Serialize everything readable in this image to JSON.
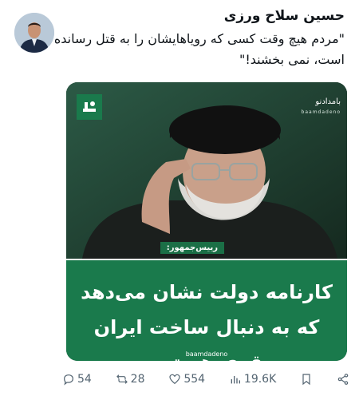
{
  "author": {
    "name": "حسین سلاح ورزی"
  },
  "tweet": {
    "text": "\"مردم هیچ وقت کسی که رویاهایشان را به قتل رسانده است، نمی بخشند!\""
  },
  "media": {
    "logo_right": "بامدادنو",
    "logo_right_sub": "baamdadeno",
    "role_label": "رییس‌جمهور:",
    "headline": "کارنامه دولت نشان می‌دهد که به دنبال ساخت ایران قوی هستیم",
    "watermark": "baamdadeno",
    "colors": {
      "green": "#1a7a4c"
    }
  },
  "actions": {
    "replies": "54",
    "reposts": "28",
    "likes": "554",
    "views": "19.6K"
  }
}
